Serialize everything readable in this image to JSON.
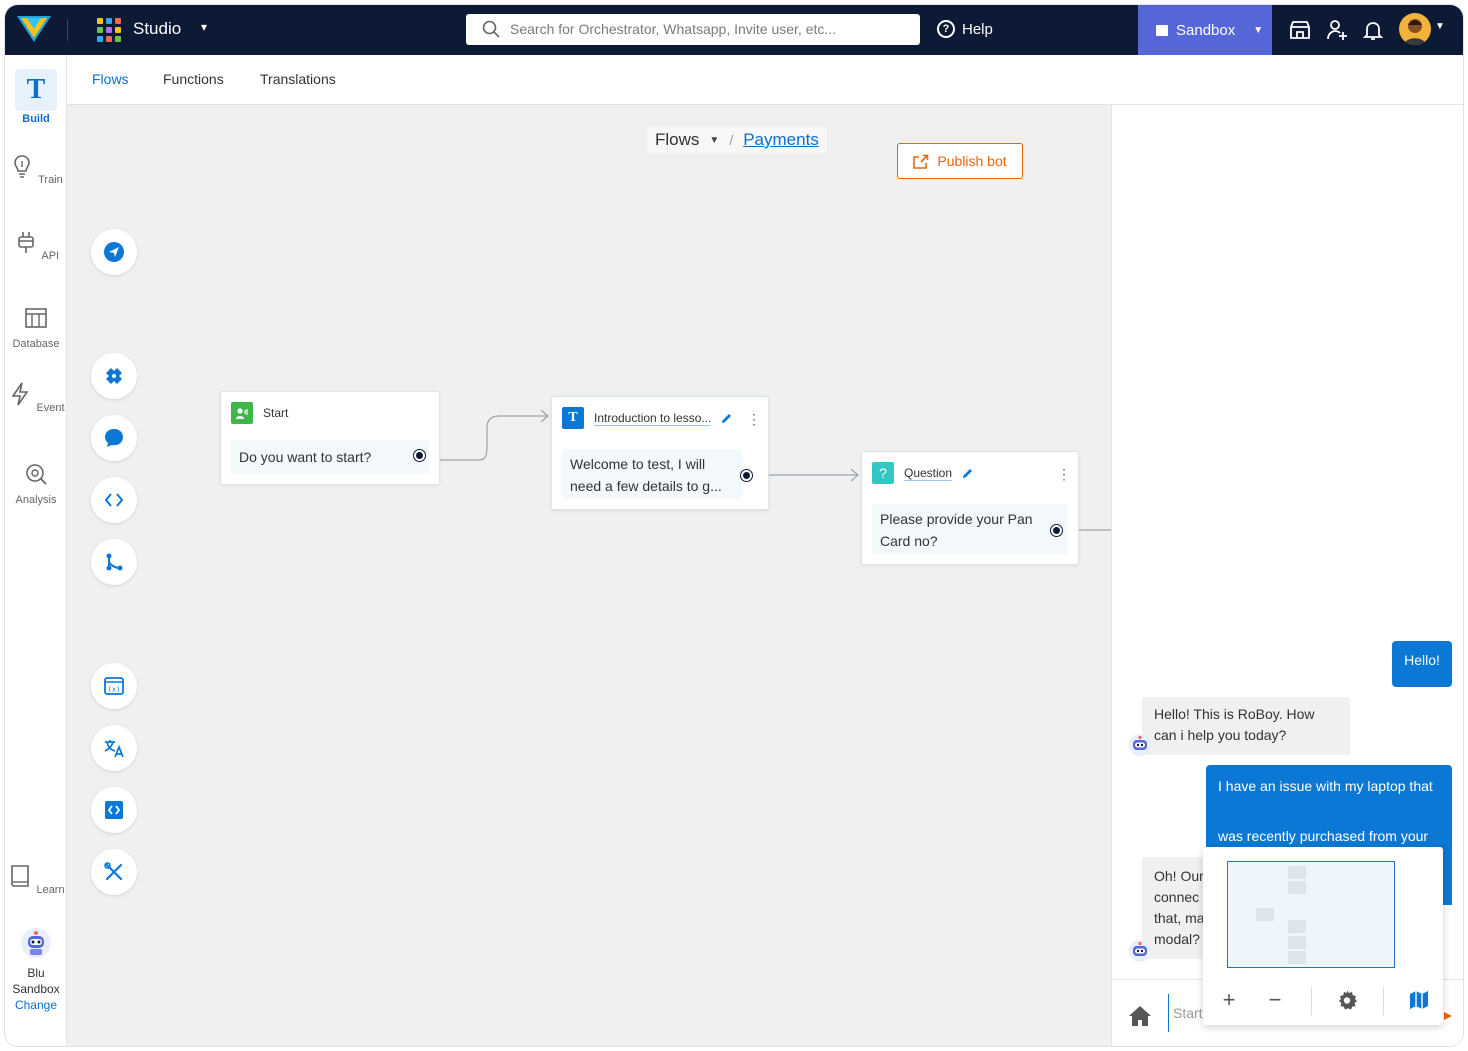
{
  "header": {
    "app_name": "Studio",
    "search_placeholder": "Search for Orchestrator, Whatsapp, Invite user, etc...",
    "help_label": "Help",
    "environment_label": "Sandbox",
    "brand_color": "#0c1a36",
    "sandbox_color": "#5566d8"
  },
  "leftnav": {
    "items": [
      {
        "label": "Build",
        "icon": "build-t-icon",
        "active": true
      },
      {
        "label": "Train",
        "icon": "bulb-icon"
      },
      {
        "label": "API",
        "icon": "plug-icon"
      },
      {
        "label": "Database",
        "icon": "table-icon"
      },
      {
        "label": "Event",
        "icon": "bolt-icon"
      },
      {
        "label": "Analysis",
        "icon": "analysis-icon"
      },
      {
        "label": "Learn",
        "icon": "book-icon"
      }
    ],
    "bot_name": "Blu",
    "bot_env": "Sandbox",
    "change_label": "Change"
  },
  "tabs": [
    {
      "label": "Flows",
      "active": true
    },
    {
      "label": "Functions"
    },
    {
      "label": "Translations"
    }
  ],
  "canvas": {
    "breadcrumb_root": "Flows",
    "breadcrumb_current": "Payments",
    "publish_label": "Publish bot",
    "publish_color": "#e8660f",
    "tools": [
      "send-icon",
      "puzzle-icon",
      "chat-icon",
      "code-icon",
      "branch-icon",
      "variable-icon",
      "translate-icon",
      "code-block-icon",
      "tools-icon"
    ],
    "nodes": [
      {
        "title": "Start",
        "body": "Do you want to start?"
      },
      {
        "title": "Introduction to lesso...",
        "body_line1": "Welcome to test, I will",
        "body_line2": "need a few details to g..."
      },
      {
        "title": "Question",
        "body_line1": "Please  provide your Pan",
        "body_line2": "Card no?"
      }
    ]
  },
  "chat": {
    "messages": [
      {
        "from": "user",
        "text": "Hello!"
      },
      {
        "from": "bot",
        "line1": "Hello! This is RoBoy. How",
        "line2": "can i help you today?"
      },
      {
        "from": "user",
        "line1": "I have an issue with my laptop that",
        "line2": "was recently purchased from your"
      },
      {
        "from": "bot",
        "line1": "Oh! Our",
        "line2": "connec",
        "line3": "that, ma",
        "line4": "modal?"
      }
    ],
    "input_placeholder": "Start",
    "minimap_controls": [
      "zoom-in-icon",
      "zoom-out-icon",
      "settings-icon",
      "map-icon"
    ]
  }
}
